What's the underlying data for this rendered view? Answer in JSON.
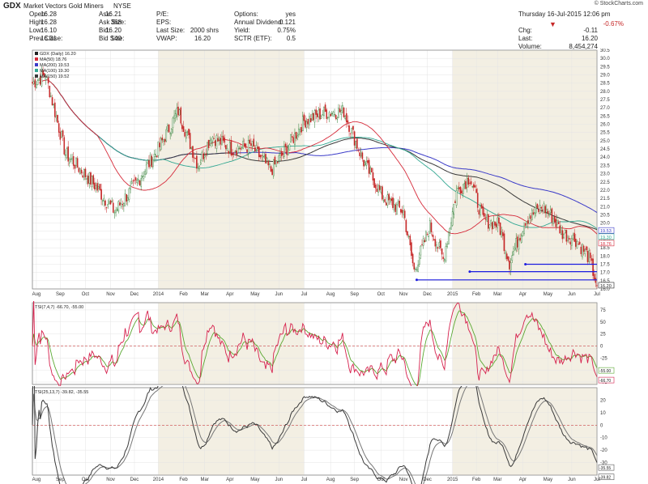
{
  "header": {
    "symbol": "GDX",
    "name": "Market Vectors Gold Miners",
    "exchange": "NYSE",
    "logo": "© StockCharts.com",
    "date": "Thursday 16-Jul-2015 12:06 pm",
    "change_pct": "-0.67%",
    "stats": [
      {
        "label": "Open:",
        "value": "16.28"
      },
      {
        "label": "High:",
        "value": "16.28"
      },
      {
        "label": "Low:",
        "value": "16.10"
      },
      {
        "label": "Prev Close:",
        "value": "16.31"
      },
      {
        "label": "Ask:",
        "value": "16.21"
      },
      {
        "label": "Ask Size:",
        "value": "368"
      },
      {
        "label": "Bid:",
        "value": "16.20"
      },
      {
        "label": "Bid Size:",
        "value": "140"
      },
      {
        "label": "P/E:",
        "value": ""
      },
      {
        "label": "EPS:",
        "value": ""
      },
      {
        "label": "Last Size:",
        "value": "2000 shrs"
      },
      {
        "label": "VWAP:",
        "value": "16.20"
      },
      {
        "label": "Options:",
        "value": "yes"
      },
      {
        "label": "Annual Dividend:",
        "value": "0.121"
      },
      {
        "label": "Yield:",
        "value": "0.75%"
      },
      {
        "label": "SCTR (ETF):",
        "value": "0.5"
      },
      {
        "label": "Chg:",
        "value": "-0.11"
      },
      {
        "label": "Last:",
        "value": "16.20"
      },
      {
        "label": "Volume:",
        "value": "8,454,274"
      }
    ]
  },
  "colors": {
    "price_up": "#2e7d32",
    "price_down": "#c62828",
    "ma50": "#d62b3a",
    "ma200": "#3a3ac8",
    "ma100": "#33a892",
    "ma150": "#3a3a3a",
    "tsi_fast": "#d6214d",
    "tsi_signal": "#5aa832",
    "tsi_slow": "#3a3a3a",
    "tsi_slow_signal": "#777777",
    "bands": "#f3efe3",
    "hline": "#1d1de0"
  },
  "chart_data": [
    {
      "type": "candlestick",
      "legend": [
        "GDX (Daily) 16.20",
        "MA(50) 18.76",
        "MA(200) 19.53",
        "MA(100) 19.30",
        "MA(150) 19.52"
      ],
      "ylim": [
        16.0,
        30.5
      ],
      "yticks": [
        "30.5",
        "30.0",
        "29.5",
        "29.0",
        "28.5",
        "28.0",
        "27.5",
        "27.0",
        "26.5",
        "26.0",
        "25.5",
        "25.0",
        "24.5",
        "24.0",
        "23.5",
        "23.0",
        "22.5",
        "22.0",
        "21.5",
        "21.0",
        "20.5",
        "20.0",
        "19.5",
        "19.0",
        "18.5",
        "18.0",
        "17.5",
        "17.0",
        "16.5",
        "16.0"
      ],
      "last_labels": [
        "19.53",
        "19.30",
        "18.76",
        "16.20"
      ],
      "months": [
        "Aug",
        "Sep",
        "Oct",
        "Nov",
        "Dec",
        "2014",
        "Feb",
        "Mar",
        "Apr",
        "May",
        "Jun",
        "Jul",
        "Aug",
        "Sep",
        "Oct",
        "Nov",
        "Dec",
        "2015",
        "Feb",
        "Mar",
        "Apr",
        "May",
        "Jun",
        "Jul"
      ],
      "anchors": [
        [
          0,
          28.5
        ],
        [
          10,
          29.0
        ],
        [
          25,
          24.2
        ],
        [
          45,
          22.5
        ],
        [
          62,
          20.7
        ],
        [
          80,
          22.6
        ],
        [
          95,
          24.5
        ],
        [
          110,
          26.8
        ],
        [
          125,
          23.5
        ],
        [
          135,
          25.3
        ],
        [
          150,
          24.5
        ],
        [
          165,
          24.7
        ],
        [
          180,
          23.2
        ],
        [
          190,
          24.3
        ],
        [
          205,
          26.2
        ],
        [
          220,
          26.7
        ],
        [
          235,
          26.8
        ],
        [
          250,
          23.7
        ],
        [
          265,
          21.5
        ],
        [
          280,
          20.7
        ],
        [
          288,
          17.1
        ],
        [
          300,
          19.8
        ],
        [
          310,
          17.8
        ],
        [
          320,
          21.9
        ],
        [
          330,
          22.8
        ],
        [
          340,
          20.2
        ],
        [
          352,
          19.9
        ],
        [
          360,
          17.6
        ],
        [
          372,
          20.2
        ],
        [
          385,
          21.0
        ],
        [
          392,
          20.4
        ],
        [
          400,
          19.4
        ],
        [
          410,
          19.0
        ],
        [
          420,
          17.9
        ],
        [
          426,
          16.2
        ]
      ],
      "hlines": [
        [
          372,
          17.5
        ],
        [
          330,
          17.05
        ],
        [
          290,
          16.55
        ]
      ]
    },
    {
      "type": "line",
      "title": "TSI(7,4,7) -66.70, -55.00",
      "ylim": [
        -80,
        90
      ],
      "yticks": [
        "75",
        "50",
        "25",
        "0",
        "-25",
        "-50",
        "-75"
      ],
      "last_labels": [
        "-55.00",
        "-66.70"
      ]
    },
    {
      "type": "line",
      "title": "TSI(25,13,7) -39.82, -35.55",
      "ylim": [
        -40,
        30
      ],
      "yticks": [
        "20",
        "10",
        "0",
        "-10",
        "-20",
        "-30"
      ],
      "last_labels": [
        "-35.55",
        "-39.82"
      ]
    }
  ]
}
